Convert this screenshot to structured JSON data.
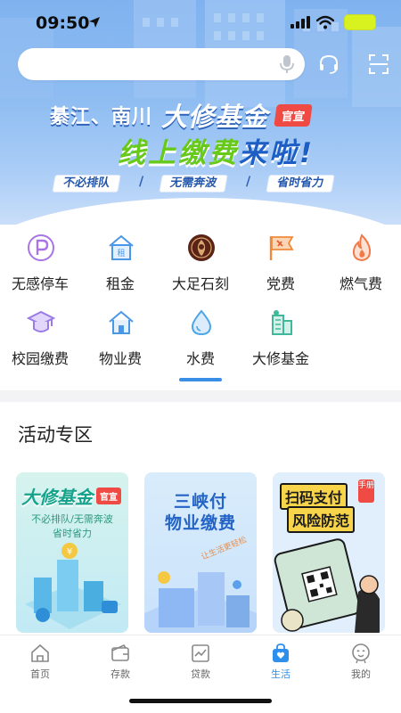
{
  "status_bar": {
    "time": "09:50"
  },
  "search": {
    "placeholder": ""
  },
  "banner": {
    "place": "綦江、南川",
    "fund": "大修基金",
    "official": "官宣",
    "line2_part1": "线上缴费",
    "line2_part2": "来啦",
    "line2_part3": "!",
    "tags": [
      "不必排队",
      "无需奔波",
      "省时省力"
    ],
    "separator": "/"
  },
  "services": [
    {
      "label": "无感停车",
      "icon": "parking-icon",
      "color": "#a874e8"
    },
    {
      "label": "租金",
      "icon": "rent-house-icon",
      "color": "#4a97e8"
    },
    {
      "label": "大足石刻",
      "icon": "dazu-rock-carving-icon",
      "color": "#6b2a1a"
    },
    {
      "label": "党费",
      "icon": "party-flag-icon",
      "color": "#f0a04a"
    },
    {
      "label": "燃气费",
      "icon": "flame-icon",
      "color": "#f07a4a"
    },
    {
      "label": "校园缴费",
      "icon": "graduation-cap-icon",
      "color": "#9a7ae8"
    },
    {
      "label": "物业费",
      "icon": "house-icon",
      "color": "#4a97e8"
    },
    {
      "label": "水费",
      "icon": "water-drop-icon",
      "color": "#4aa6e8"
    },
    {
      "label": "大修基金",
      "icon": "building-fund-icon",
      "color": "#3fb89b"
    }
  ],
  "section": {
    "title": "活动专区"
  },
  "cards": {
    "c1": {
      "title": "大修基金",
      "badge": "官宣",
      "sub1": "不必排队/无需奔波",
      "sub2": "省时省力"
    },
    "c2": {
      "title1": "三峡付",
      "title2": "物业缴费",
      "sub": "让生活更轻松"
    },
    "c3": {
      "title1": "扫码支付",
      "title2": "风险防范",
      "badge": "手册"
    }
  },
  "tabs": [
    {
      "label": "首页",
      "icon": "home-icon"
    },
    {
      "label": "存款",
      "icon": "wallet-icon"
    },
    {
      "label": "贷款",
      "icon": "chart-icon"
    },
    {
      "label": "生活",
      "icon": "shopping-bag-heart-icon",
      "active": true
    },
    {
      "label": "我的",
      "icon": "user-icon"
    }
  ],
  "colors": {
    "accent": "#2f8fec",
    "official_red": "#ef4b44",
    "banner_green": "#67c91a",
    "banner_blue": "#1d5ec4"
  }
}
